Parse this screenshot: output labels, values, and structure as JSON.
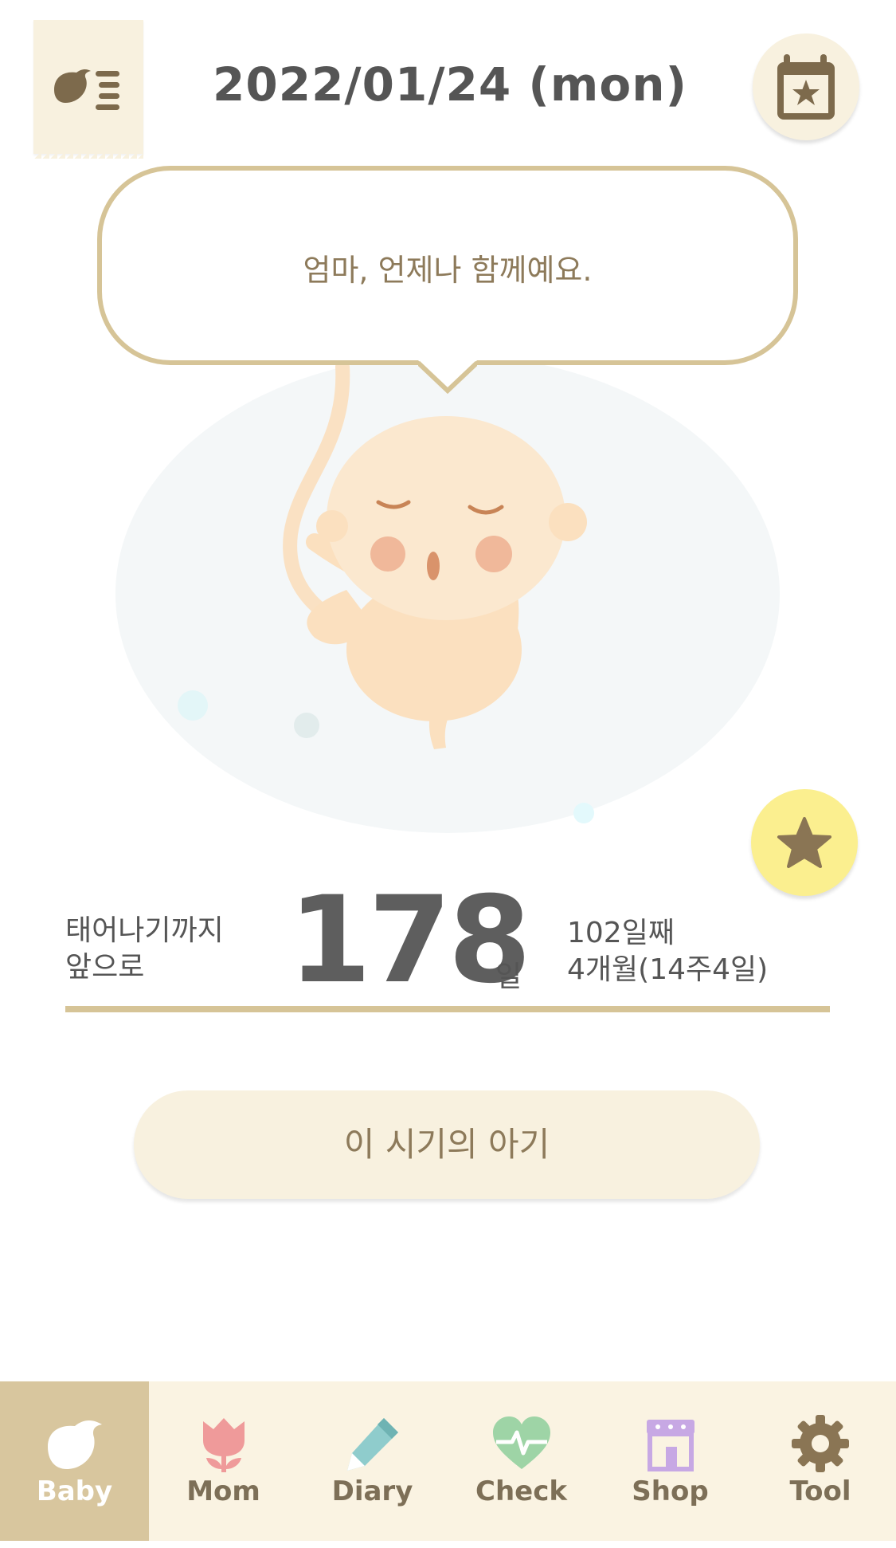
{
  "header": {
    "date": "2022/01/24 (mon)"
  },
  "speech": {
    "text": "엄마, 언제나 함께예요."
  },
  "countdown": {
    "until_line1": "태어나기까지",
    "until_line2": "앞으로",
    "days_left": "178",
    "day_unit": "일",
    "elapsed_days": "102일째",
    "elapsed_period": "4개월(14주4일)"
  },
  "info_button": {
    "label": "이 시기의 아기"
  },
  "colors": {
    "accent_gold": "#d6c497",
    "cream": "#f8f1df",
    "star_yellow": "#fbef8f",
    "text_brown": "#8d7a5a"
  },
  "nav": {
    "active": "Baby",
    "items": [
      {
        "label": "Baby",
        "icon": "bird-icon"
      },
      {
        "label": "Mom",
        "icon": "tulip-icon"
      },
      {
        "label": "Diary",
        "icon": "pencil-icon"
      },
      {
        "label": "Check",
        "icon": "heart-pulse-icon"
      },
      {
        "label": "Shop",
        "icon": "shop-icon"
      },
      {
        "label": "Tool",
        "icon": "gear-icon"
      }
    ]
  }
}
